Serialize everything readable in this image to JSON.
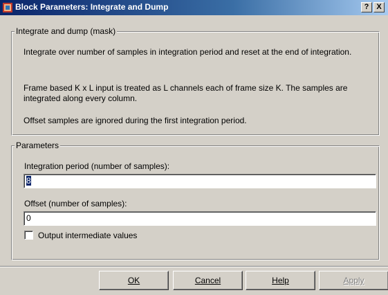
{
  "window": {
    "title": "Block Parameters: Integrate and Dump",
    "help_glyph": "?",
    "close_glyph": "X"
  },
  "mask_group": {
    "legend": "Integrate and dump (mask)",
    "description_1": "Integrate over number of samples in integration period and reset at the end of integration.",
    "description_2": "Frame based K x L input is treated as L channels each of frame size K. The samples are integrated along every column.",
    "description_3": "Offset samples are ignored during the first integration period."
  },
  "parameters_group": {
    "legend": "Parameters",
    "integration_period_label": "Integration period (number of samples):",
    "integration_period_value": "8",
    "offset_label": "Offset (number of samples):",
    "offset_value": "0",
    "output_intermediate_label": "Output intermediate values",
    "output_intermediate_checked": false
  },
  "buttons": {
    "ok": "OK",
    "cancel": "Cancel",
    "help": "Help",
    "apply": "Apply"
  },
  "colors": {
    "title_bar": "#0a246a",
    "dialog_face": "#d4d0c8",
    "selection": "#0a246a"
  },
  "icons": {
    "app": "simulink-block-icon"
  }
}
